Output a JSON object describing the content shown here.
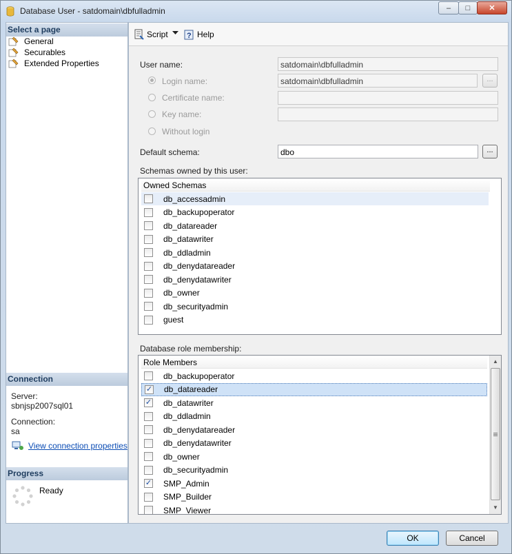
{
  "window": {
    "title": "Database User - satdomain\\dbfulladmin",
    "controls": {
      "minimize": "–",
      "maximize": "□",
      "close": "✕"
    }
  },
  "left": {
    "select_page_header": "Select a page",
    "pages": [
      {
        "label": "General",
        "icon": "page-wrench-icon"
      },
      {
        "label": "Securables",
        "icon": "page-wrench-icon"
      },
      {
        "label": "Extended Properties",
        "icon": "page-wrench-icon"
      }
    ],
    "connection_header": "Connection",
    "server_label": "Server:",
    "server_value": "sbnjsp2007sql01",
    "connection_label": "Connection:",
    "connection_value": "sa",
    "view_link": "View connection properties",
    "progress_header": "Progress",
    "progress_status": "Ready"
  },
  "toolbar": {
    "script": "Script",
    "help": "Help"
  },
  "form": {
    "user_name_label": "User name:",
    "user_name_value": "satdomain\\dbfulladmin",
    "login_name_label": "Login name:",
    "login_name_value": "satdomain\\dbfulladmin",
    "certificate_name_label": "Certificate name:",
    "certificate_name_value": "",
    "key_name_label": "Key name:",
    "key_name_value": "",
    "without_login_label": "Without login",
    "default_schema_label": "Default schema:",
    "default_schema_value": "dbo",
    "ellipsis": "..."
  },
  "schemas": {
    "label": "Schemas owned by this user:",
    "column": "Owned Schemas",
    "items": [
      {
        "name": "db_accessadmin",
        "checked": false
      },
      {
        "name": "db_backupoperator",
        "checked": false
      },
      {
        "name": "db_datareader",
        "checked": false
      },
      {
        "name": "db_datawriter",
        "checked": false
      },
      {
        "name": "db_ddladmin",
        "checked": false
      },
      {
        "name": "db_denydatareader",
        "checked": false
      },
      {
        "name": "db_denydatawriter",
        "checked": false
      },
      {
        "name": "db_owner",
        "checked": false
      },
      {
        "name": "db_securityadmin",
        "checked": false
      },
      {
        "name": "guest",
        "checked": false
      }
    ]
  },
  "roles": {
    "label": "Database role membership:",
    "column": "Role Members",
    "items": [
      {
        "name": "db_backupoperator",
        "checked": false
      },
      {
        "name": "db_datareader",
        "checked": true
      },
      {
        "name": "db_datawriter",
        "checked": true
      },
      {
        "name": "db_ddladmin",
        "checked": false
      },
      {
        "name": "db_denydatareader",
        "checked": false
      },
      {
        "name": "db_denydatawriter",
        "checked": false
      },
      {
        "name": "db_owner",
        "checked": false
      },
      {
        "name": "db_securityadmin",
        "checked": false
      },
      {
        "name": "SMP_Admin",
        "checked": true
      },
      {
        "name": "SMP_Builder",
        "checked": false
      },
      {
        "name": "SMP_Viewer",
        "checked": false
      }
    ]
  },
  "buttons": {
    "ok": "OK",
    "cancel": "Cancel"
  },
  "colors": {
    "link": "#0b4cb4",
    "header_text": "#1f3d5f",
    "selection": "#cfe2f7"
  }
}
